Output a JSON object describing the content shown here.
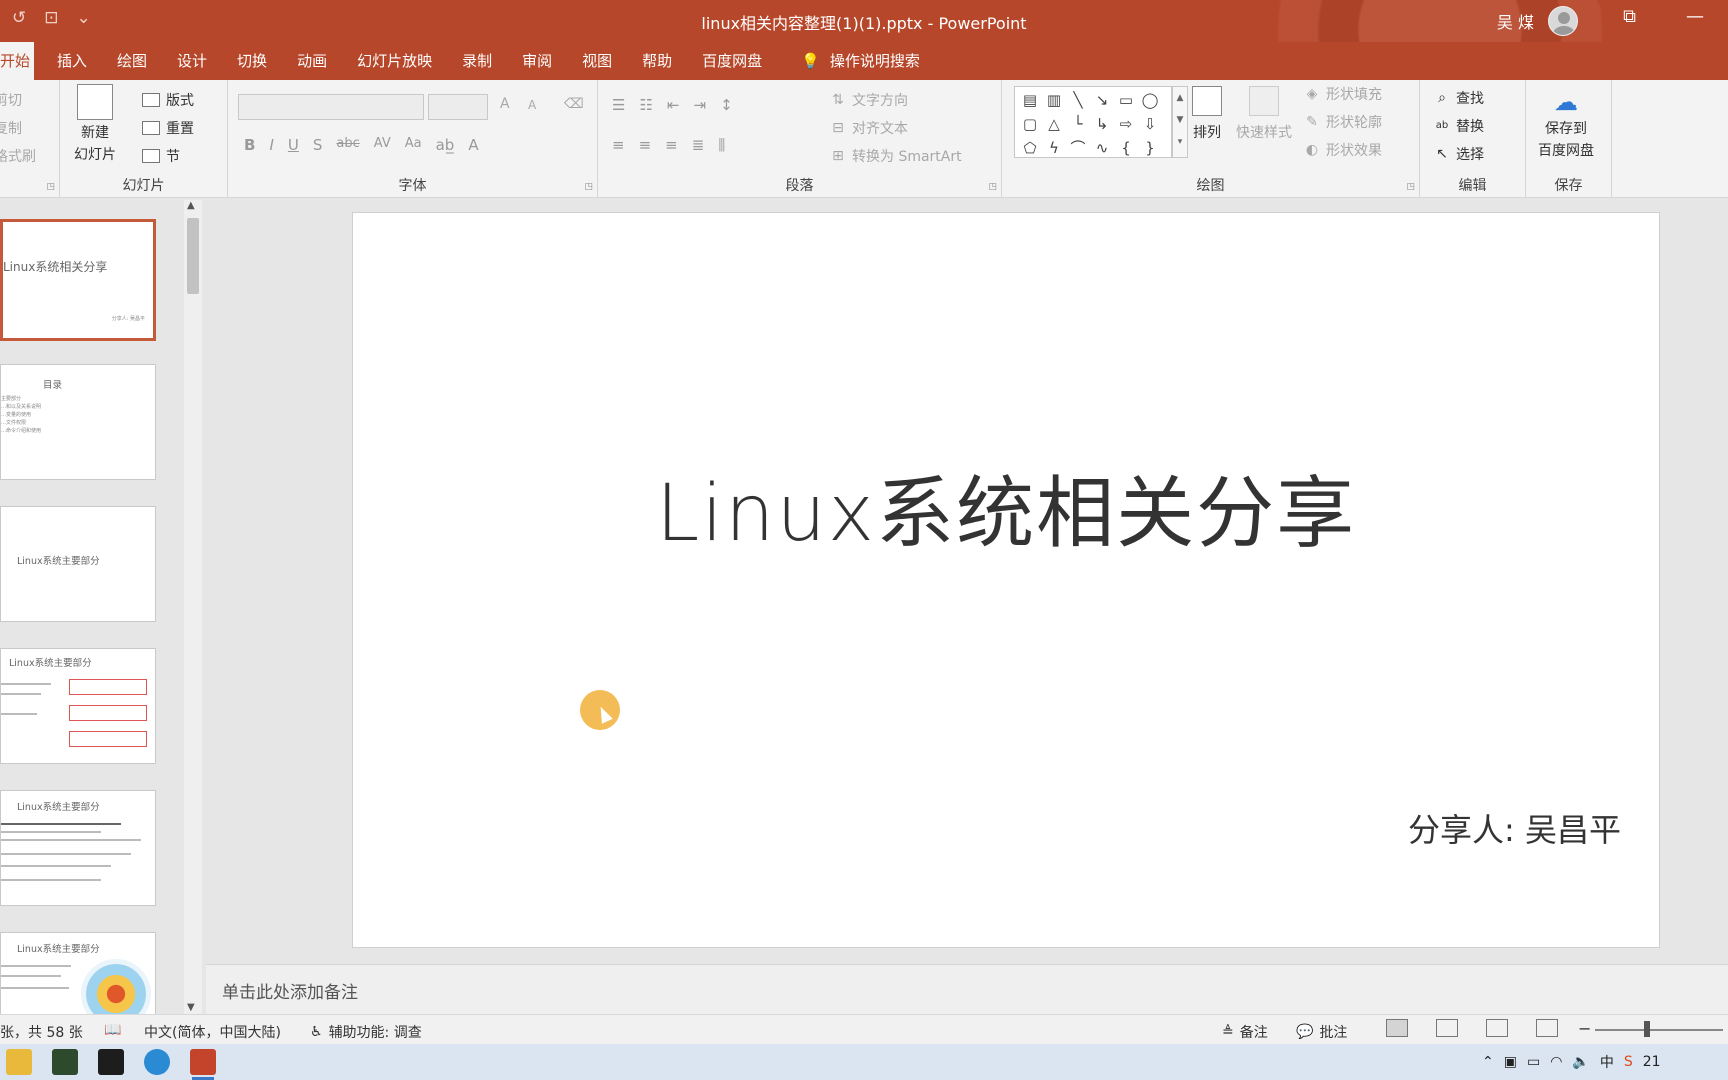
{
  "titlebar": {
    "doc_title": "linux相关内容整理(1)(1).pptx  -  PowerPoint",
    "user_name": "吴 煤",
    "accent": "#b7472a"
  },
  "qat": {
    "undo_icon": "↺",
    "present_icon": "⊡",
    "more_icon": "⌄"
  },
  "window": {
    "restore": "⧉",
    "minimize": "—"
  },
  "tabs": [
    {
      "label": "开始",
      "active": true
    },
    {
      "label": "插入"
    },
    {
      "label": "绘图"
    },
    {
      "label": "设计"
    },
    {
      "label": "切换"
    },
    {
      "label": "动画"
    },
    {
      "label": "幻灯片放映"
    },
    {
      "label": "录制"
    },
    {
      "label": "审阅"
    },
    {
      "label": "视图"
    },
    {
      "label": "帮助"
    },
    {
      "label": "百度网盘"
    }
  ],
  "tell_me": "操作说明搜索",
  "ribbon": {
    "clipboard": {
      "cut": "剪切",
      "copy": "复制",
      "format_painter": "格式刷"
    },
    "slides": {
      "new_slide": "新建",
      "new_slide_2": "幻灯片",
      "layout": "版式",
      "reset": "重置",
      "section": "节",
      "label": "幻灯片"
    },
    "font": {
      "label": "字体",
      "bold": "B",
      "italic": "I",
      "underline": "U",
      "shadow": "S",
      "strike": "abc",
      "spacing": "AV",
      "case": "Aa",
      "grow": "A",
      "shrink": "A",
      "font_color": "A"
    },
    "paragraph": {
      "label": "段落",
      "text_direction": "文字方向",
      "align_text": "对齐文本",
      "smartart": "转换为 SmartArt"
    },
    "drawing": {
      "label": "绘图",
      "arrange": "排列",
      "quick_styles": "快速样式",
      "shape_fill": "形状填充",
      "shape_outline": "形状轮廓",
      "shape_effects": "形状效果"
    },
    "editing": {
      "label": "编辑",
      "find": "查找",
      "replace": "替换",
      "select": "选择"
    },
    "save": {
      "label": "保存",
      "save_to": "保存到",
      "baidu": "百度网盘"
    }
  },
  "thumbnails": [
    {
      "title": "Linux系统相关分享",
      "subtitle": "分享人: 吴昌平"
    },
    {
      "title": "目录",
      "lines": [
        "主要部分",
        "…和以及关系说明",
        "…变量的使用",
        "…文件权限",
        "…命令介绍和使用"
      ]
    },
    {
      "title": "Linux系统主要部分"
    },
    {
      "title": "Linux系统主要部分"
    },
    {
      "title": "Linux系统主要部分"
    },
    {
      "title": "Linux系统主要部分"
    }
  ],
  "slide": {
    "title": "Linux系统相关分享",
    "subtitle": "分享人: 吴昌平"
  },
  "notes_placeholder": "单击此处添加备注",
  "status": {
    "slide_count": "张，共 58 张",
    "language": "中文(简体，中国大陆)",
    "accessibility": "辅助功能: 调查",
    "notes": "备注",
    "comments": "批注",
    "zoom_out": "−"
  },
  "taskbar": {
    "clock": "21"
  }
}
